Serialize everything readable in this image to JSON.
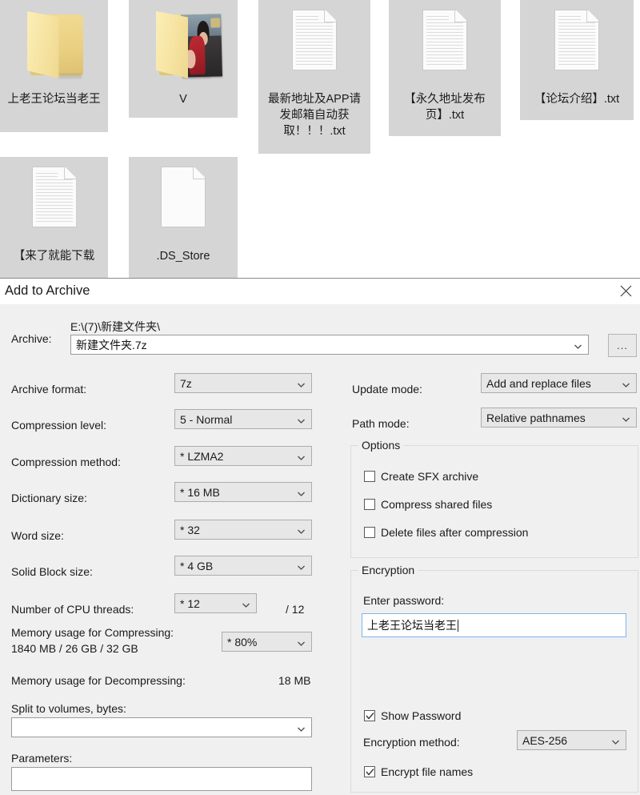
{
  "desktop": {
    "files": [
      {
        "name": "上老王论坛当老王",
        "type": "folder",
        "selected": true
      },
      {
        "name": "V",
        "type": "folder-photo",
        "selected": true
      },
      {
        "name": "最新地址及APP请发邮箱自动获取！！！.txt",
        "type": "text-file",
        "selected": true
      },
      {
        "name": "【永久地址发布页】.txt",
        "type": "text-file",
        "selected": true
      },
      {
        "name": "【论坛介绍】.txt",
        "type": "text-file",
        "selected": true
      },
      {
        "name": "【来了就能下载",
        "type": "text-file",
        "selected": true
      },
      {
        "name": ".DS_Store",
        "type": "blank-file",
        "selected": true
      }
    ]
  },
  "dialog": {
    "title": "Add to Archive",
    "close_label": "✕",
    "archive": {
      "label": "Archive:",
      "path": "E:\\(7)\\新建文件夹\\",
      "filename": "新建文件夹.7z",
      "browse_label": "..."
    },
    "left": {
      "archive_format_label": "Archive format:",
      "archive_format_value": "7z",
      "compression_level_label": "Compression level:",
      "compression_level_value": "5 - Normal",
      "compression_method_label": "Compression method:",
      "compression_method_value": "*  LZMA2",
      "dictionary_size_label": "Dictionary size:",
      "dictionary_size_value": "*  16 MB",
      "word_size_label": "Word size:",
      "word_size_value": "*  32",
      "solid_block_label": "Solid Block size:",
      "solid_block_value": "*  4 GB",
      "cpu_threads_label": "Number of CPU threads:",
      "cpu_threads_value": "*  12",
      "cpu_threads_total": "/ 12",
      "mem_compress_label": "Memory usage for Compressing:",
      "mem_compress_detail": "1840 MB / 26 GB / 32 GB",
      "mem_compress_value": "* 80%",
      "mem_decompress_label": "Memory usage for Decompressing:",
      "mem_decompress_value": "18 MB",
      "split_label": "Split to volumes, bytes:",
      "split_value": "",
      "parameters_label": "Parameters:",
      "parameters_value": ""
    },
    "right": {
      "update_mode_label": "Update mode:",
      "update_mode_value": "Add and replace files",
      "path_mode_label": "Path mode:",
      "path_mode_value": "Relative pathnames",
      "options_group_title": "Options",
      "options": [
        {
          "label": "Create SFX archive",
          "checked": false
        },
        {
          "label": "Compress shared files",
          "checked": false
        },
        {
          "label": "Delete files after compression",
          "checked": false
        }
      ],
      "encryption_group_title": "Encryption",
      "enter_password_label": "Enter password:",
      "password_value": "上老王论坛当老王",
      "show_password": {
        "label": "Show Password",
        "checked": true
      },
      "encryption_method_label": "Encryption method:",
      "encryption_method_value": "AES-256",
      "encrypt_filenames": {
        "label": "Encrypt file names",
        "checked": true
      }
    }
  },
  "colors": {
    "dialog_bg": "#f0f0f0",
    "selection_bg": "#d5d5d5",
    "combo_bg": "#e7e7e7",
    "focus_border": "#7eb4ea",
    "folder_yellow": "#f2dd9a"
  }
}
